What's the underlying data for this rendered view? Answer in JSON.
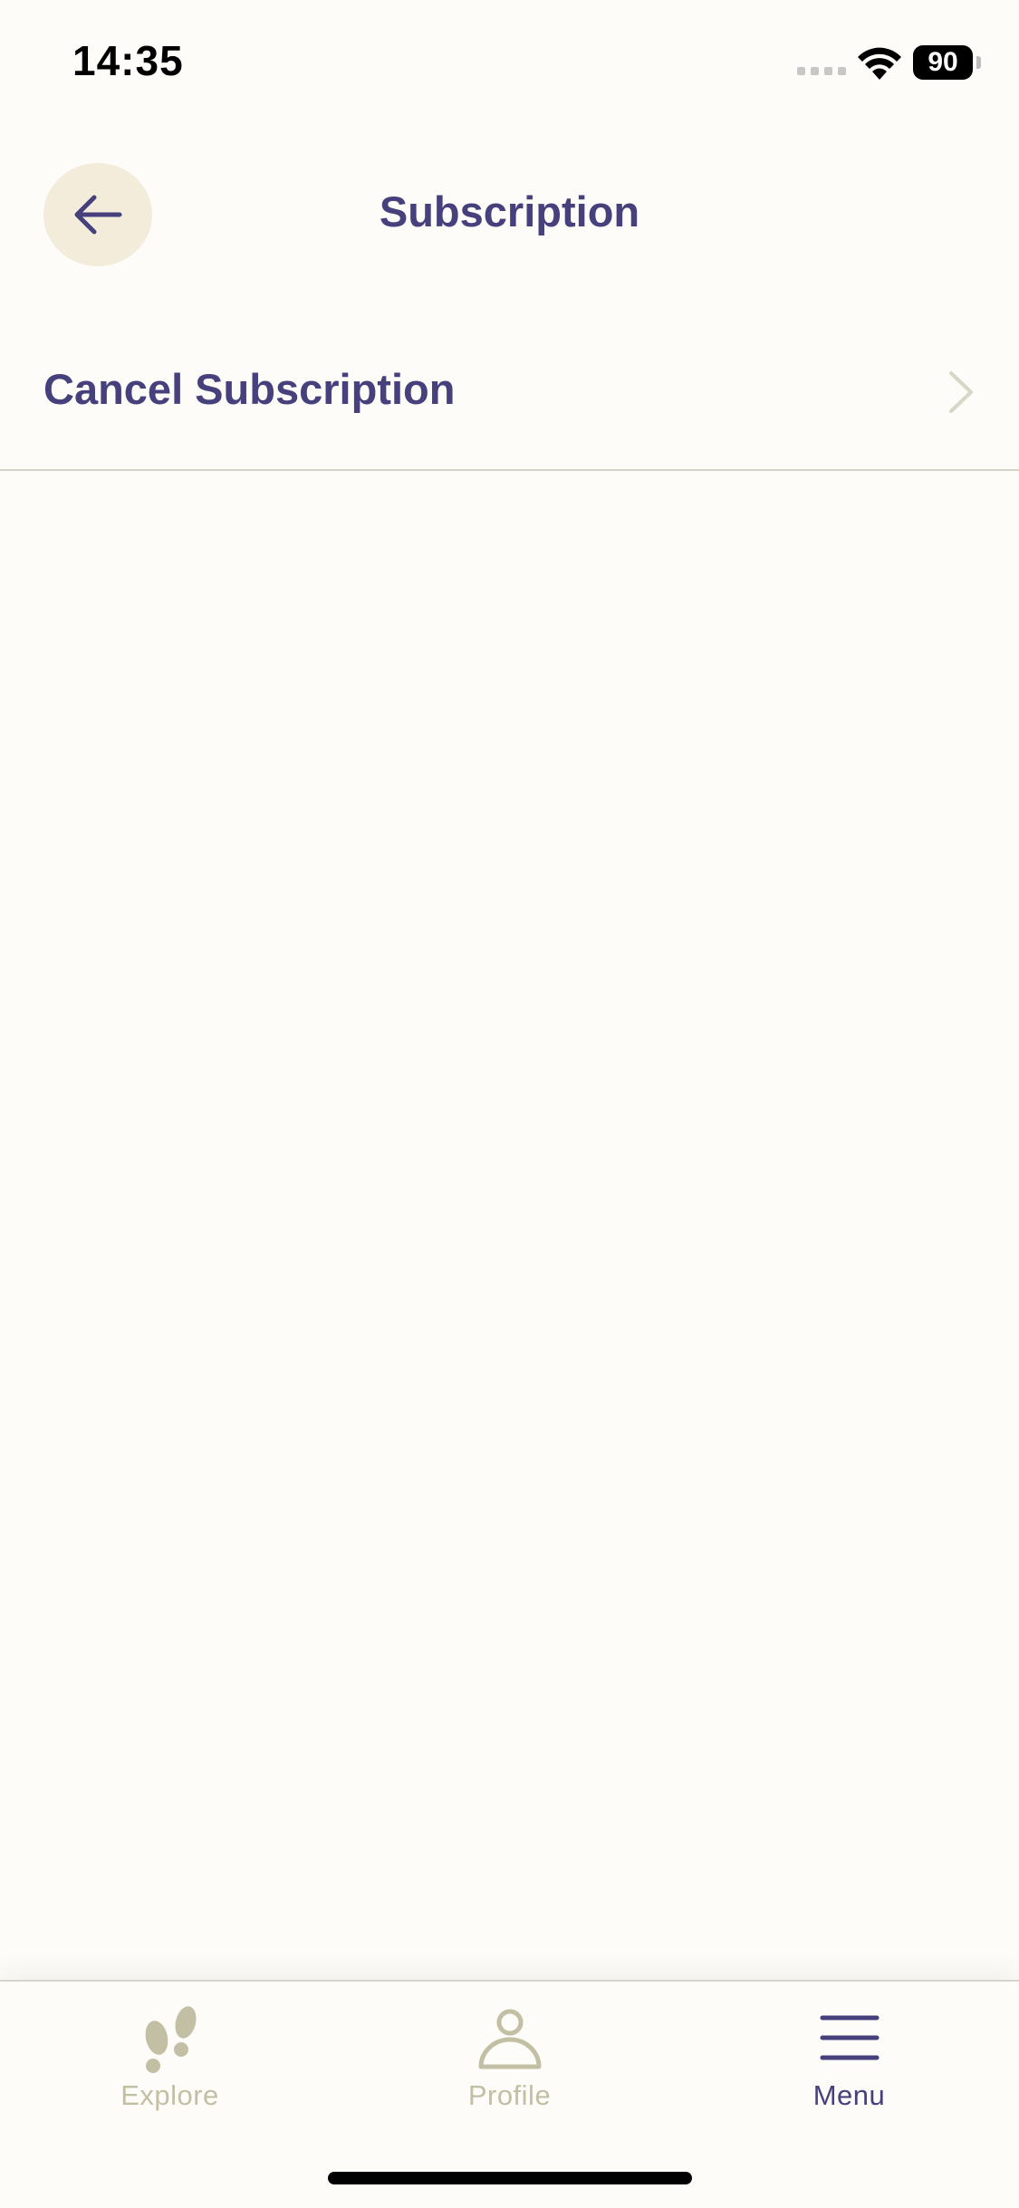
{
  "status_bar": {
    "time": "14:35",
    "battery": "90"
  },
  "header": {
    "title": "Subscription",
    "back_icon": "arrow-left-icon"
  },
  "list": {
    "items": [
      {
        "label": "Cancel Subscription",
        "icon": "chevron-right-icon"
      }
    ]
  },
  "tab_bar": {
    "tabs": [
      {
        "label": "Explore",
        "icon": "footprints-icon",
        "active": false
      },
      {
        "label": "Profile",
        "icon": "person-icon",
        "active": false
      },
      {
        "label": "Menu",
        "icon": "menu-icon",
        "active": true
      }
    ]
  },
  "colors": {
    "background": "#fdfcf8",
    "accent": "#46417c",
    "muted": "#c2bfa4",
    "back_button_bg": "#f4ecdb"
  }
}
